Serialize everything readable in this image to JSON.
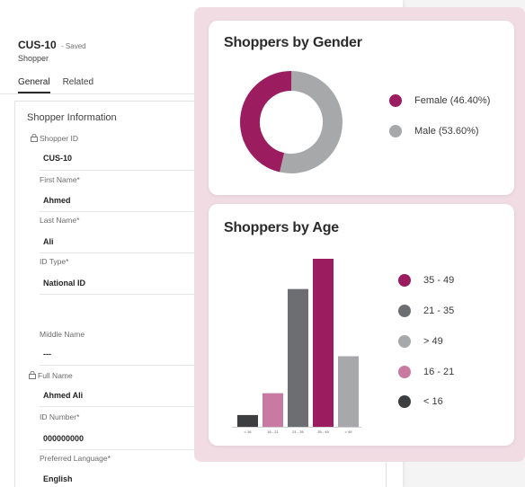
{
  "record": {
    "id": "CUS-10",
    "status": "- Saved",
    "entity": "Shopper"
  },
  "tabs": [
    "General",
    "Related"
  ],
  "section": {
    "title": "Shopper Information",
    "fields": [
      {
        "label": "Shopper ID",
        "value": "CUS-10",
        "locked": true
      },
      {
        "label": "First Name*",
        "value": "Ahmed"
      },
      {
        "label": "Last Name*",
        "value": "Ali"
      },
      {
        "label": "ID Type*",
        "value": "National ID"
      },
      {
        "label": "Middle Name",
        "value": "---"
      },
      {
        "label": "Full Name",
        "value": "Ahmed  Ali",
        "locked": true
      },
      {
        "label": "ID Number*",
        "value": "000000000"
      },
      {
        "label": "Preferred Language*",
        "value": "English"
      }
    ]
  },
  "colors": {
    "female": "#9b1d5f",
    "male": "#a7a8aa",
    "age_35_49": "#9b1d5f",
    "age_21_35": "#6d6e71",
    "age_gt_49": "#a7a8aa",
    "age_16_21": "#c97aa3",
    "age_lt_16": "#3d3e40",
    "overlay_bg": "#f1dce4"
  },
  "gender_card": {
    "title": "Shoppers by Gender",
    "legend": [
      {
        "label": "Female (46.40%)",
        "color_key": "female"
      },
      {
        "label": "Male (53.60%)",
        "color_key": "male"
      }
    ]
  },
  "age_card": {
    "title": "Shoppers by Age",
    "legend": [
      {
        "label": "35 - 49",
        "color_key": "age_35_49"
      },
      {
        "label": "21 - 35",
        "color_key": "age_21_35"
      },
      {
        "label": "> 49",
        "color_key": "age_gt_49"
      },
      {
        "label": "16 - 21",
        "color_key": "age_16_21"
      },
      {
        "label": "< 16",
        "color_key": "age_lt_16"
      }
    ]
  },
  "chart_data": [
    {
      "type": "pie",
      "title": "Shoppers by Gender",
      "donut": true,
      "categories": [
        "Female",
        "Male"
      ],
      "values": [
        46.4,
        53.6
      ],
      "legend_position": "right"
    },
    {
      "type": "bar",
      "title": "Shoppers by Age",
      "categories": [
        "< 16",
        "16 - 21",
        "21 - 35",
        "35 - 49",
        "> 49"
      ],
      "tick_labels": [
        "< 16",
        "16 - 21",
        "21 - 35",
        "35 - 49",
        "> 49"
      ],
      "values": [
        7,
        20,
        82,
        100,
        42
      ],
      "unit": "relative",
      "ylim": [
        0,
        100
      ],
      "legend_position": "right"
    }
  ]
}
